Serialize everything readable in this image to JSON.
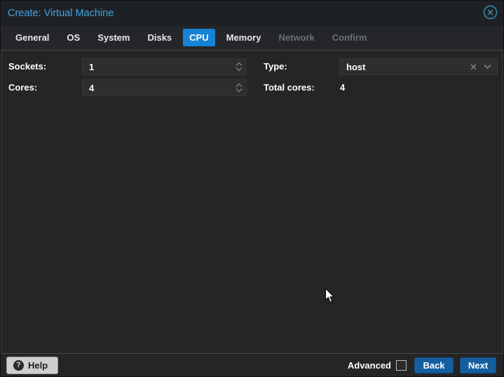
{
  "window": {
    "title": "Create: Virtual Machine",
    "close_icon": "circle-x-icon"
  },
  "tabs": [
    {
      "label": "General",
      "state": "normal"
    },
    {
      "label": "OS",
      "state": "normal"
    },
    {
      "label": "System",
      "state": "normal"
    },
    {
      "label": "Disks",
      "state": "normal"
    },
    {
      "label": "CPU",
      "state": "active"
    },
    {
      "label": "Memory",
      "state": "normal"
    },
    {
      "label": "Network",
      "state": "disabled"
    },
    {
      "label": "Confirm",
      "state": "disabled"
    }
  ],
  "form": {
    "sockets": {
      "label": "Sockets:",
      "value": "1",
      "control": "number-spinner"
    },
    "cores": {
      "label": "Cores:",
      "value": "4",
      "control": "number-spinner"
    },
    "type": {
      "label": "Type:",
      "value": "host",
      "control": "combobox",
      "tools": [
        "clear-x-icon",
        "chevron-down-icon"
      ]
    },
    "total_cores": {
      "label": "Total cores:",
      "value": "4",
      "control": "static-text"
    }
  },
  "footer": {
    "help": "Help",
    "help_icon": "question-circle-icon",
    "advanced": "Advanced",
    "advanced_checked": false,
    "back": "Back",
    "next": "Next"
  },
  "colors": {
    "title_blue": "#42a3e0",
    "active_tab_blue": "#1583d6",
    "button_blue": "#155fa0",
    "header_bg": "#1d2126",
    "body_bg": "#252525",
    "field_bg": "#2e2e2e"
  }
}
